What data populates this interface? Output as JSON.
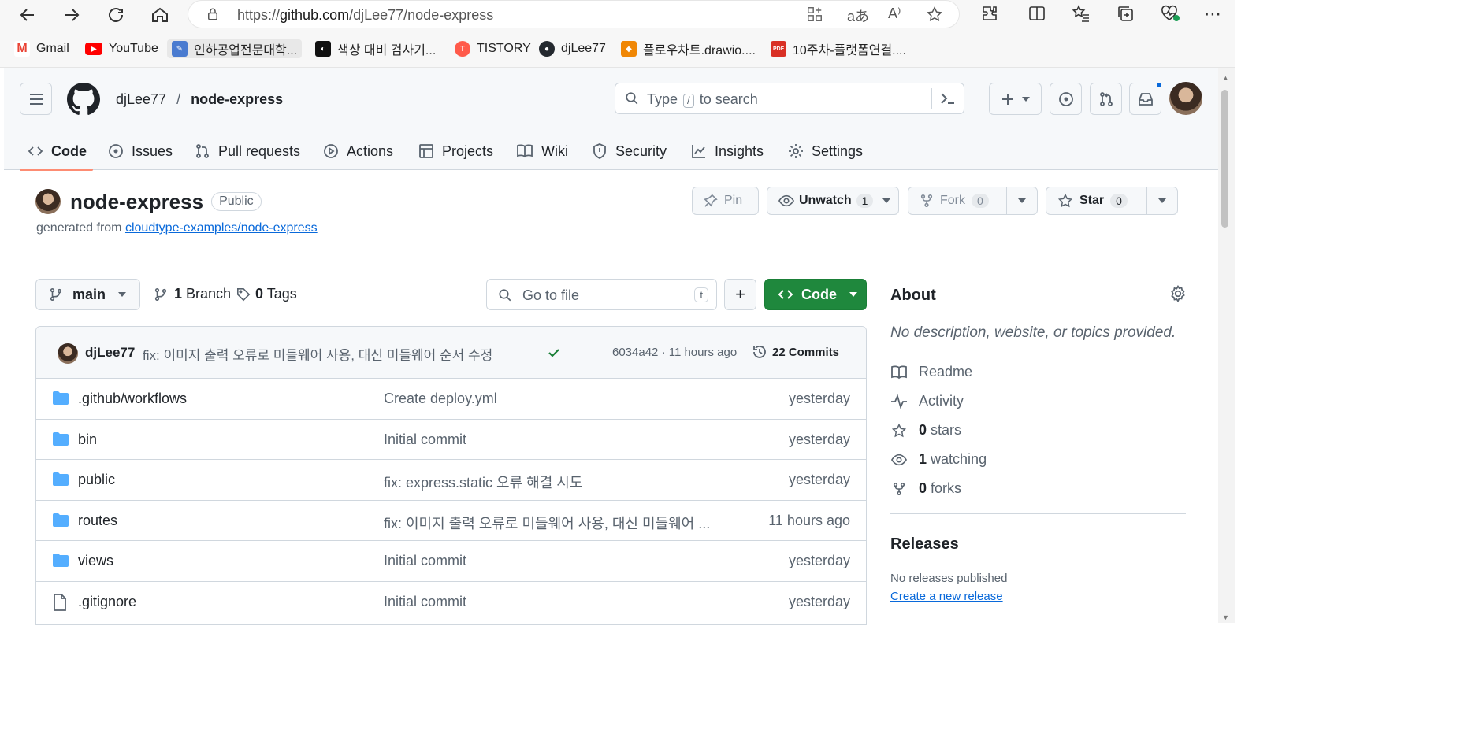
{
  "browser": {
    "url_prefix": "https://",
    "url_host": "github.com",
    "url_path": "/djLee77/node-express"
  },
  "bookmarks": [
    {
      "label": "Gmail",
      "color": "#ea4335",
      "glyph": "M"
    },
    {
      "label": "YouTube",
      "color": "#ff0000",
      "glyph": "▶"
    },
    {
      "label": "인하공업전문대학...",
      "color": "#4a7bd0",
      "glyph": "✎"
    },
    {
      "label": "색상 대비 검사기...",
      "color": "#111111",
      "glyph": "◐"
    },
    {
      "label": "TISTORY",
      "color": "#ff5a4a",
      "glyph": "T"
    },
    {
      "label": "djLee77",
      "color": "#24292f",
      "glyph": "●"
    },
    {
      "label": "플로우차트.drawio....",
      "color": "#f08705",
      "glyph": "◆"
    },
    {
      "label": "10주차-플랫폼연결....",
      "color": "#d93025",
      "glyph": "PDF"
    }
  ],
  "header": {
    "owner": "djLee77",
    "separator": "/",
    "repo": "node-express",
    "search_prefix": "Type",
    "search_key": "/",
    "search_suffix": "to search"
  },
  "tabs": [
    {
      "label": "Code",
      "icon": "code-icon"
    },
    {
      "label": "Issues",
      "icon": "issue-icon"
    },
    {
      "label": "Pull requests",
      "icon": "pull-request-icon"
    },
    {
      "label": "Actions",
      "icon": "play-icon"
    },
    {
      "label": "Projects",
      "icon": "table-icon"
    },
    {
      "label": "Wiki",
      "icon": "book-icon"
    },
    {
      "label": "Security",
      "icon": "shield-icon"
    },
    {
      "label": "Insights",
      "icon": "graph-icon"
    },
    {
      "label": "Settings",
      "icon": "gear-icon"
    }
  ],
  "repo": {
    "name": "node-express",
    "visibility": "Public",
    "generated_prefix": "generated from",
    "template_link": "cloudtype-examples/node-express",
    "pin": "Pin",
    "unwatch": "Unwatch",
    "watch_count": "1",
    "fork": "Fork",
    "fork_count": "0",
    "star": "Star",
    "star_count": "0"
  },
  "toolbar": {
    "branch": "main",
    "branch_count": "1",
    "branch_label": "Branch",
    "tag_count": "0",
    "tag_label": "Tags",
    "goto_placeholder": "Go to file",
    "goto_key": "t",
    "add_label": "+",
    "code_label": "Code"
  },
  "latest_commit": {
    "author": "djLee77",
    "message": "fix: 이미지 출력 오류로 미들웨어 사용, 대신 미들웨어 순서 수정",
    "hash_time": "6034a42 · 11 hours ago",
    "commits": "22 Commits"
  },
  "files": [
    {
      "name": ".github/workflows",
      "type": "folder",
      "message": "Create deploy.yml",
      "date": "yesterday"
    },
    {
      "name": "bin",
      "type": "folder",
      "message": "Initial commit",
      "date": "yesterday"
    },
    {
      "name": "public",
      "type": "folder",
      "message": "fix: express.static 오류 해결 시도",
      "date": "yesterday"
    },
    {
      "name": "routes",
      "type": "folder",
      "message": "fix: 이미지 출력 오류로 미들웨어 사용, 대신 미들웨어 ...",
      "date": "11 hours ago"
    },
    {
      "name": "views",
      "type": "folder",
      "message": "Initial commit",
      "date": "yesterday"
    },
    {
      "name": ".gitignore",
      "type": "file",
      "message": "Initial commit",
      "date": "yesterday"
    }
  ],
  "about": {
    "title": "About",
    "description": "No description, website, or topics provided.",
    "readme": "Readme",
    "activity": "Activity",
    "stars_count": "0",
    "stars_label": "stars",
    "watching_count": "1",
    "watching_label": "watching",
    "forks_count": "0",
    "forks_label": "forks",
    "releases_title": "Releases",
    "no_releases": "No releases published",
    "create_release": "Create a new release"
  },
  "colors": {
    "accent_green": "#1f883d",
    "link_blue": "#0969da",
    "tab_underline": "#fd8c73",
    "notification_dot": "#0969da"
  }
}
